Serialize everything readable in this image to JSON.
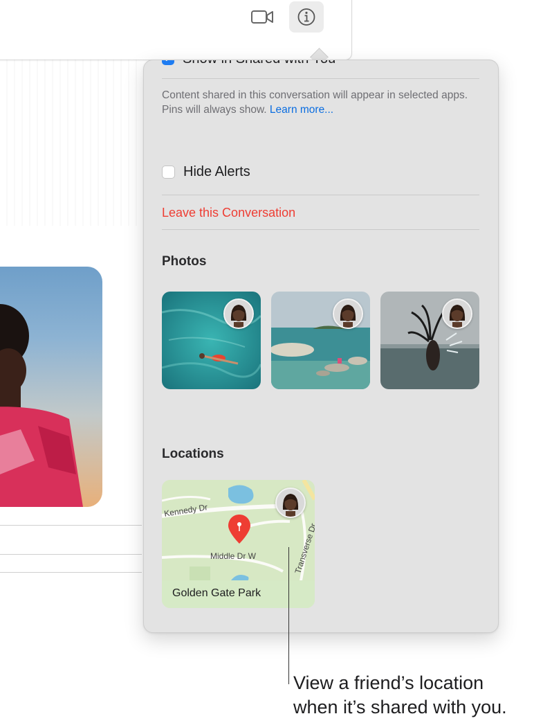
{
  "toolbar": {
    "video_icon": "video-camera-icon",
    "info_icon": "info-icon"
  },
  "details_panel": {
    "shared_with_you_label": "Show in Shared with You",
    "shared_note": "Content shared in this conversation will appear in selected apps. Pins will always show.",
    "learn_more_link": "Learn more...",
    "hide_alerts_label": "Hide Alerts",
    "hide_alerts_checked": false,
    "shared_with_you_checked": true,
    "leave_label": "Leave this Conversation",
    "photos_title": "Photos",
    "photos": [
      {
        "subject": "swimmer floating in turquoise water"
      },
      {
        "subject": "rocky beach with clear water"
      },
      {
        "subject": "person flipping hair in water"
      }
    ],
    "locations_title": "Locations",
    "location": {
      "name": "Golden Gate Park",
      "roads": [
        "Kennedy Dr",
        "Middle Dr W",
        "Transverse Dr"
      ]
    }
  },
  "callout": {
    "text": "View a friend’s location when it’s shared with you."
  },
  "colors": {
    "accent": "#1e7cf2",
    "link": "#0a6de0",
    "destructive": "#ee3d33",
    "panel_bg": "#e3e3e3",
    "map_pin": "#ee3d33"
  }
}
